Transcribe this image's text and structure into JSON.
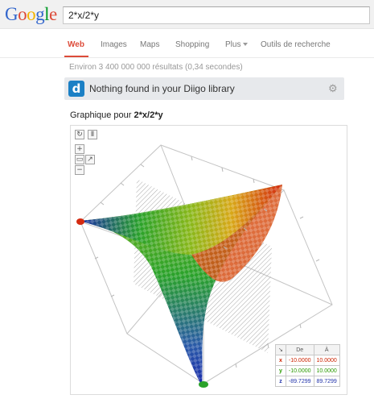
{
  "header": {
    "logo_letters": [
      {
        "char": "G",
        "color": "#3366cc"
      },
      {
        "char": "o",
        "color": "#dd4b39"
      },
      {
        "char": "o",
        "color": "#f4b400"
      },
      {
        "char": "g",
        "color": "#3366cc"
      },
      {
        "char": "l",
        "color": "#009925"
      },
      {
        "char": "e",
        "color": "#dd4b39"
      }
    ],
    "query": "2*x/2*y"
  },
  "tabs": [
    {
      "label": "Web",
      "active": true
    },
    {
      "label": "Images",
      "active": false
    },
    {
      "label": "Maps",
      "active": false
    },
    {
      "label": "Shopping",
      "active": false
    },
    {
      "label": "Plus",
      "active": false
    },
    {
      "label": "Outils de recherche",
      "active": false
    }
  ],
  "result_stats": "Environ 3 400 000 000 résultats (0,34 secondes)",
  "diigo": {
    "logo_letter": "d",
    "message": "Nothing found in your Diigo library"
  },
  "graph": {
    "title_prefix": "Graphique pour ",
    "title_expr": "2*x/2*y",
    "controls": {
      "reset": "↻",
      "pause": "Ⅱ",
      "zoom_in": "+",
      "zoom_out": "−"
    },
    "range_table": {
      "headers": [
        "De",
        "À"
      ],
      "rows": [
        {
          "axis": "x",
          "from": "-10.0000",
          "to": "10.0000",
          "color": "#cc2200"
        },
        {
          "axis": "y",
          "from": "-10.0000",
          "to": "10.0000",
          "color": "#2a9a00"
        },
        {
          "axis": "z",
          "from": "-89.7299",
          "to": "89.7299",
          "color": "#2233aa"
        }
      ]
    },
    "colors": {
      "red": "#d42a10",
      "orange": "#e8781a",
      "yellow": "#cccc1a",
      "green": "#2aa22a",
      "blue": "#1a2aaa"
    }
  }
}
